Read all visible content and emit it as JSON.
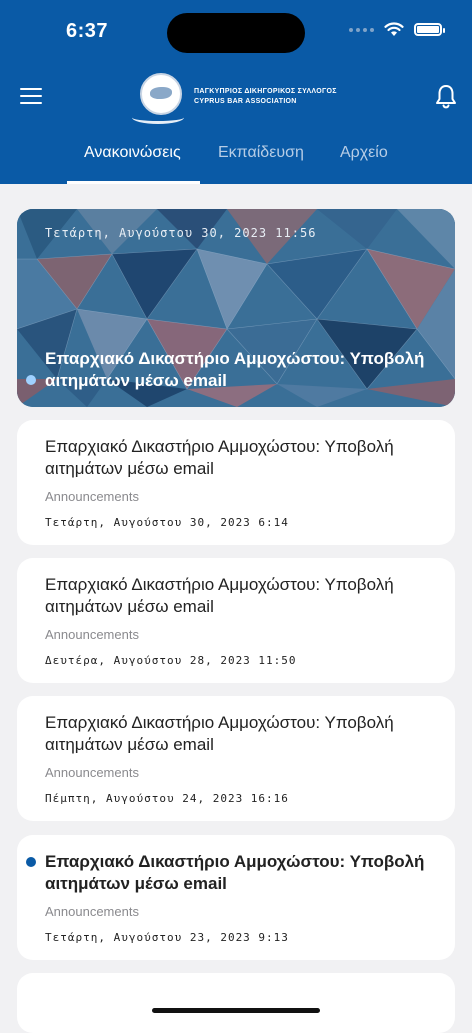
{
  "status": {
    "time": "6:37"
  },
  "header": {
    "logo_line1": "ΠΑΓΚΥΠΡΙΟΣ ΔΙΚΗΓΟΡΙΚΟΣ ΣΥΛΛΟΓΟΣ",
    "logo_line2": "CYPRUS BAR ASSOCIATION",
    "menu_icon": "hamburger-icon",
    "bell_icon": "bell-icon",
    "color": "#0a5aa6"
  },
  "tabs": [
    {
      "label": "Ανακοινώσεις",
      "active": true
    },
    {
      "label": "Εκπαίδευση",
      "active": false
    },
    {
      "label": "Αρχείο",
      "active": false
    }
  ],
  "featured": {
    "date": "Τετάρτη, Αυγούστου 30, 2023 11:56",
    "title": "Επαρχιακό Δικαστήριο Αμμοχώστου: Υποβολή αιτημάτων μέσω email",
    "unread": true
  },
  "items": [
    {
      "title": "Επαρχιακό Δικαστήριο Αμμοχώστου: Υποβολή αιτημάτων μέσω email",
      "category": "Announcements",
      "date": "Τετάρτη, Αυγούστου 30, 2023 6:14",
      "unread": false
    },
    {
      "title": "Επαρχιακό Δικαστήριο Αμμοχώστου: Υποβολή αιτημάτων μέσω email",
      "category": "Announcements",
      "date": "Δευτέρα, Αυγούστου 28, 2023 11:50",
      "unread": false
    },
    {
      "title": "Επαρχιακό Δικαστήριο Αμμοχώστου: Υποβολή αιτημάτων μέσω email",
      "category": "Announcements",
      "date": "Πέμπτη, Αυγούστου 24, 2023 16:16",
      "unread": false
    },
    {
      "title": "Επαρχιακό Δικαστήριο Αμμοχώστου: Υποβολή αιτημάτων μέσω email",
      "category": "Announcements",
      "date": "Τετάρτη, Αυγούστου 23, 2023 9:13",
      "unread": true
    }
  ]
}
